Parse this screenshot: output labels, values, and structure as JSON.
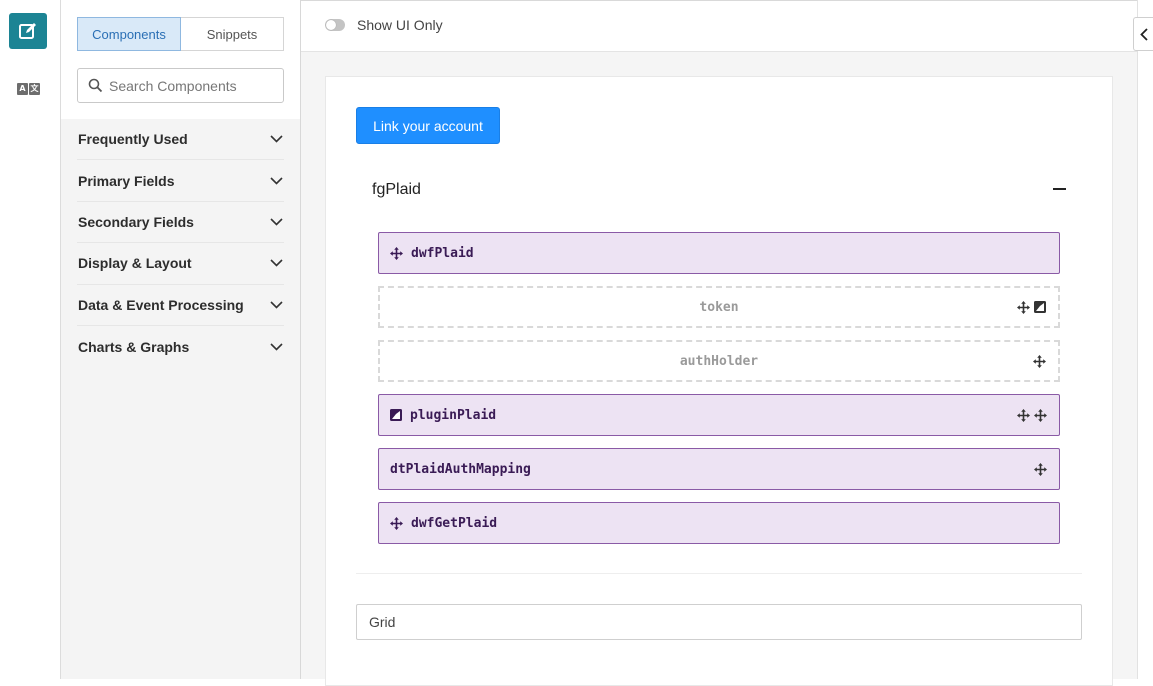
{
  "sidebar": {
    "tabs": [
      {
        "label": "Components",
        "active": true
      },
      {
        "label": "Snippets",
        "active": false
      }
    ],
    "search": {
      "placeholder": "Search Components"
    },
    "categories": [
      {
        "label": "Frequently Used"
      },
      {
        "label": "Primary Fields"
      },
      {
        "label": "Secondary Fields"
      },
      {
        "label": "Display & Layout"
      },
      {
        "label": "Data & Event Processing"
      },
      {
        "label": "Charts & Graphs"
      }
    ]
  },
  "header": {
    "toggle_label": "Show UI Only",
    "toggle_on": false
  },
  "form": {
    "link_button": "Link your account",
    "fieldset_title": "fgPlaid",
    "rows": [
      {
        "name": "dwfPlaid",
        "style": "solid",
        "icons": [
          "move-icon"
        ]
      },
      {
        "name": "token",
        "style": "dashed",
        "icons": [
          "move-icon",
          "image-icon"
        ]
      },
      {
        "name": "authHolder",
        "style": "dashed",
        "icons": [
          "move-icon"
        ]
      },
      {
        "name": "pluginPlaid",
        "style": "solid",
        "icons": [
          "image-icon",
          "move-icon",
          "move-icon"
        ]
      },
      {
        "name": "dtPlaidAuthMapping",
        "style": "solid",
        "icons": [
          "move-icon"
        ]
      },
      {
        "name": "dwfGetPlaid",
        "style": "solid",
        "icons": [
          "move-icon"
        ]
      }
    ],
    "grid_label": "Grid"
  },
  "colors": {
    "accent": "#1f8fff",
    "rail_accent": "#1c8494",
    "row_fill": "#ede3f3",
    "row_border": "#8a5aa6"
  }
}
